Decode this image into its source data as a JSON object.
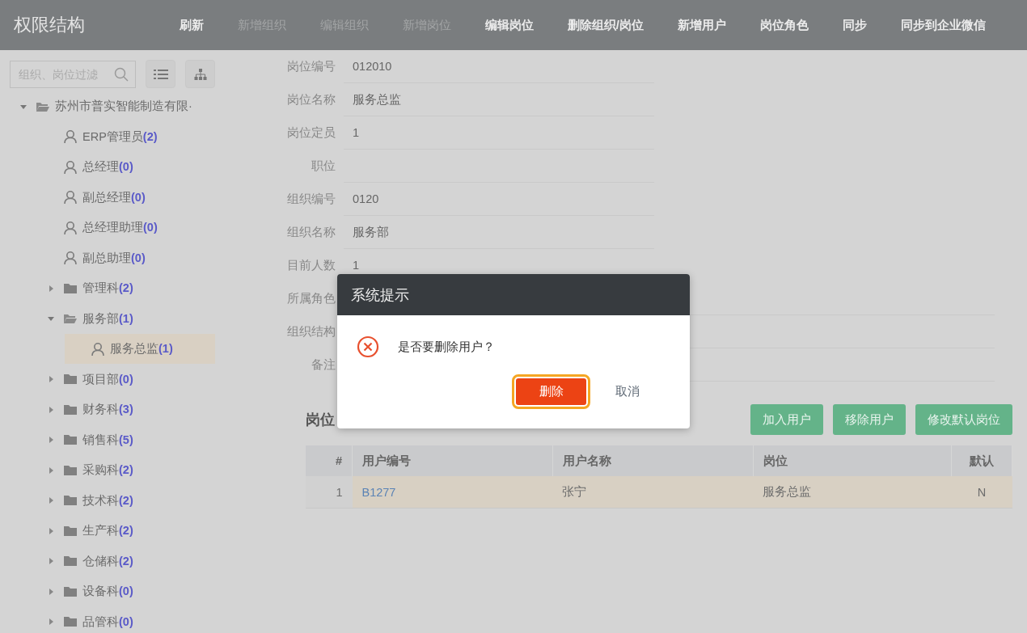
{
  "header": {
    "title": "权限结构",
    "actions": [
      {
        "label": "刷新",
        "disabled": false
      },
      {
        "label": "新增组织",
        "disabled": true
      },
      {
        "label": "编辑组织",
        "disabled": true
      },
      {
        "label": "新增岗位",
        "disabled": true
      },
      {
        "label": "编辑岗位",
        "disabled": false
      },
      {
        "label": "删除组织/岗位",
        "disabled": false
      },
      {
        "label": "新增用户",
        "disabled": false
      },
      {
        "label": "岗位角色",
        "disabled": false
      },
      {
        "label": "同步",
        "disabled": false
      },
      {
        "label": "同步到企业微信",
        "disabled": false
      }
    ]
  },
  "sidebar": {
    "search": {
      "placeholder": "组织、岗位过滤"
    },
    "tree": [
      {
        "kind": "folder",
        "label": "苏州市普实智能制造有限·",
        "expanded": true,
        "selected": false,
        "children": [
          {
            "kind": "position",
            "label": "ERP管理员",
            "count": "(2)",
            "selected": false
          },
          {
            "kind": "position",
            "label": "总经理",
            "count": "(0)",
            "selected": false
          },
          {
            "kind": "position",
            "label": "副总经理",
            "count": "(0)",
            "selected": false
          },
          {
            "kind": "position",
            "label": "总经理助理",
            "count": "(0)",
            "selected": false
          },
          {
            "kind": "position",
            "label": "副总助理",
            "count": "(0)",
            "selected": false
          },
          {
            "kind": "folder",
            "label": "管理科",
            "count": "(2)",
            "expanded": false,
            "selected": false
          },
          {
            "kind": "folder",
            "label": "服务部",
            "count": "(1)",
            "expanded": true,
            "selected": false,
            "children": [
              {
                "kind": "position",
                "label": "服务总监",
                "count": "(1)",
                "selected": true
              }
            ]
          },
          {
            "kind": "folder",
            "label": "项目部",
            "count": "(0)",
            "expanded": false,
            "selected": false
          },
          {
            "kind": "folder",
            "label": "财务科",
            "count": "(3)",
            "expanded": false,
            "selected": false
          },
          {
            "kind": "folder",
            "label": "销售科",
            "count": "(5)",
            "expanded": false,
            "selected": false
          },
          {
            "kind": "folder",
            "label": "采购科",
            "count": "(2)",
            "expanded": false,
            "selected": false
          },
          {
            "kind": "folder",
            "label": "技术科",
            "count": "(2)",
            "expanded": false,
            "selected": false
          },
          {
            "kind": "folder",
            "label": "生产科",
            "count": "(2)",
            "expanded": false,
            "selected": false
          },
          {
            "kind": "folder",
            "label": "仓储科",
            "count": "(2)",
            "expanded": false,
            "selected": false
          },
          {
            "kind": "folder",
            "label": "设备科",
            "count": "(0)",
            "expanded": false,
            "selected": false
          },
          {
            "kind": "folder",
            "label": "品管科",
            "count": "(0)",
            "expanded": false,
            "selected": false
          }
        ]
      }
    ]
  },
  "form": {
    "fields": [
      {
        "label": "岗位编号",
        "value": "012010"
      },
      {
        "label": "岗位名称",
        "value": "服务总监"
      },
      {
        "label": "岗位定员",
        "value": "1"
      },
      {
        "label": "职位"
      },
      {
        "label": "组织编号",
        "value": "0120"
      },
      {
        "label": "组织名称",
        "value": "服务部"
      },
      {
        "label": "目前人数",
        "value": "1"
      },
      {
        "label": "所属角色"
      },
      {
        "label": "组织结构"
      },
      {
        "label": "备注"
      }
    ]
  },
  "users_section": {
    "title": "岗位",
    "buttons": [
      "加入用户",
      "移除用户",
      "修改默认岗位"
    ],
    "table": {
      "columns": [
        "#",
        "用户编号",
        "用户名称",
        "岗位",
        "默认"
      ],
      "rows": [
        {
          "cells": [
            "1",
            "B1277",
            "张宁",
            "服务总监",
            "N"
          ],
          "selected": true
        }
      ]
    }
  },
  "dialog": {
    "title": "系统提示",
    "message": "是否要删除用户？",
    "buttons": [
      {
        "kind": "primary",
        "label": "删除",
        "focused": true
      },
      {
        "kind": "link",
        "label": "取消",
        "focused": false
      }
    ]
  }
}
